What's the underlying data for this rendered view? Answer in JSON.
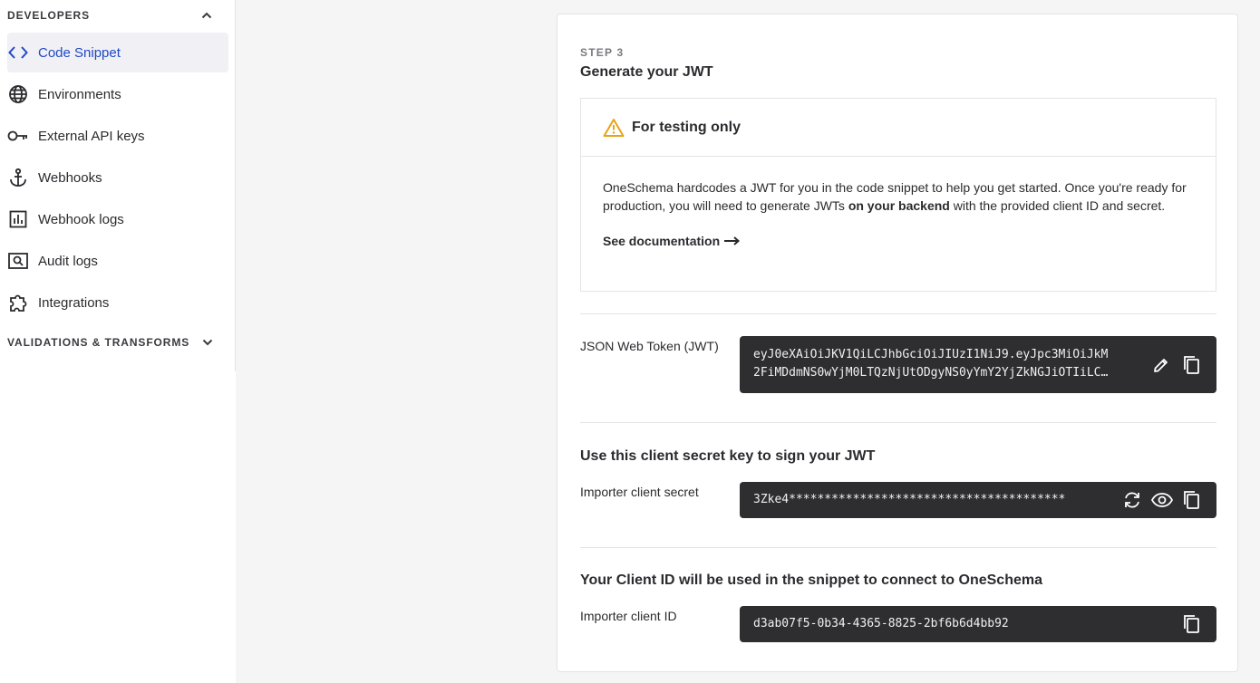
{
  "sidebar": {
    "developers_header": "DEVELOPERS",
    "validations_header": "VALIDATIONS & TRANSFORMS",
    "items": [
      {
        "label": "Code Snippet",
        "icon": "code-icon",
        "active": true
      },
      {
        "label": "Environments",
        "icon": "globe-icon",
        "active": false
      },
      {
        "label": "External API keys",
        "icon": "key-icon",
        "active": false
      },
      {
        "label": "Webhooks",
        "icon": "anchor-icon",
        "active": false
      },
      {
        "label": "Webhook logs",
        "icon": "bar-chart-icon",
        "active": false
      },
      {
        "label": "Audit logs",
        "icon": "search-document-icon",
        "active": false
      },
      {
        "label": "Integrations",
        "icon": "puzzle-icon",
        "active": false
      }
    ]
  },
  "card": {
    "step": "STEP 3",
    "title": "Generate your JWT",
    "warning": {
      "title": "For testing only",
      "body_part1": "OneSchema hardcodes a JWT for you in the code snippet to help you get started. Once you're ready for production, you will need to generate JWTs ",
      "body_bold": "on your backend",
      "body_part2": " with the provided client ID and secret.",
      "link": "See documentation"
    },
    "jwt": {
      "label": "JSON Web Token (JWT)",
      "line1": "eyJ0eXAiOiJKV1QiLCJhbGciOiJIUzI1NiJ9.eyJpc3MiOiJkM",
      "line2": "2FiMDdmNS0wYjM0LTQzNjUtODgyNS0yYmY2YjZkNGJiOTIiLC…"
    },
    "secret_section": {
      "title": "Use this client secret key to sign your JWT",
      "label": "Importer client secret",
      "value": "3Zke4***************************************"
    },
    "client_id_section": {
      "title": "Your Client ID will be used in the snippet to connect to OneSchema",
      "label": "Importer client ID",
      "value": "d3ab07f5-0b34-4365-8825-2bf6b6d4bb92"
    }
  },
  "colors": {
    "accent": "#2149c4",
    "warning": "#e8a317",
    "code_bg": "#2e2e31"
  }
}
